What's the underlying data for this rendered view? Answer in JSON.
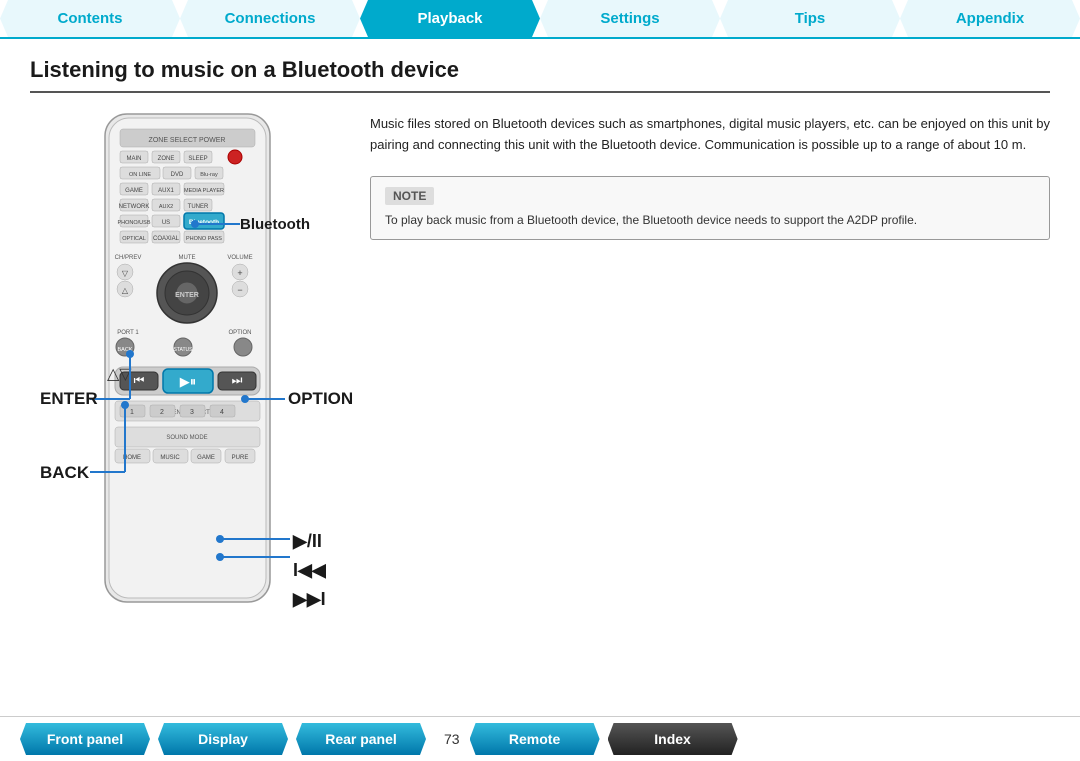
{
  "nav": {
    "tabs": [
      {
        "label": "Contents",
        "active": false
      },
      {
        "label": "Connections",
        "active": false
      },
      {
        "label": "Playback",
        "active": true
      },
      {
        "label": "Settings",
        "active": false
      },
      {
        "label": "Tips",
        "active": false
      },
      {
        "label": "Appendix",
        "active": false
      }
    ]
  },
  "page": {
    "title": "Listening to music on a Bluetooth device",
    "description": "Music files stored on Bluetooth devices such as smartphones, digital music players, etc. can be enjoyed on this unit by pairing and connecting this unit with the Bluetooth device.\nCommunication is possible up to a range of about 10 m.",
    "note_label": "NOTE",
    "note_text": "To play back music from a Bluetooth device, the Bluetooth device needs to support the A2DP profile."
  },
  "labels": {
    "bluetooth": "Bluetooth",
    "enter": "ENTER",
    "option": "OPTION",
    "back": "BACK",
    "play_pause": "▶/II",
    "skip": "I◀◀  ▶▶I",
    "delta": "△▽"
  },
  "bottom_nav": {
    "tabs": [
      {
        "label": "Front panel",
        "dark": false
      },
      {
        "label": "Display",
        "dark": false
      },
      {
        "label": "Rear panel",
        "dark": false
      },
      {
        "label": "Remote",
        "dark": false
      },
      {
        "label": "Index",
        "dark": true
      }
    ],
    "page_number": "73"
  }
}
